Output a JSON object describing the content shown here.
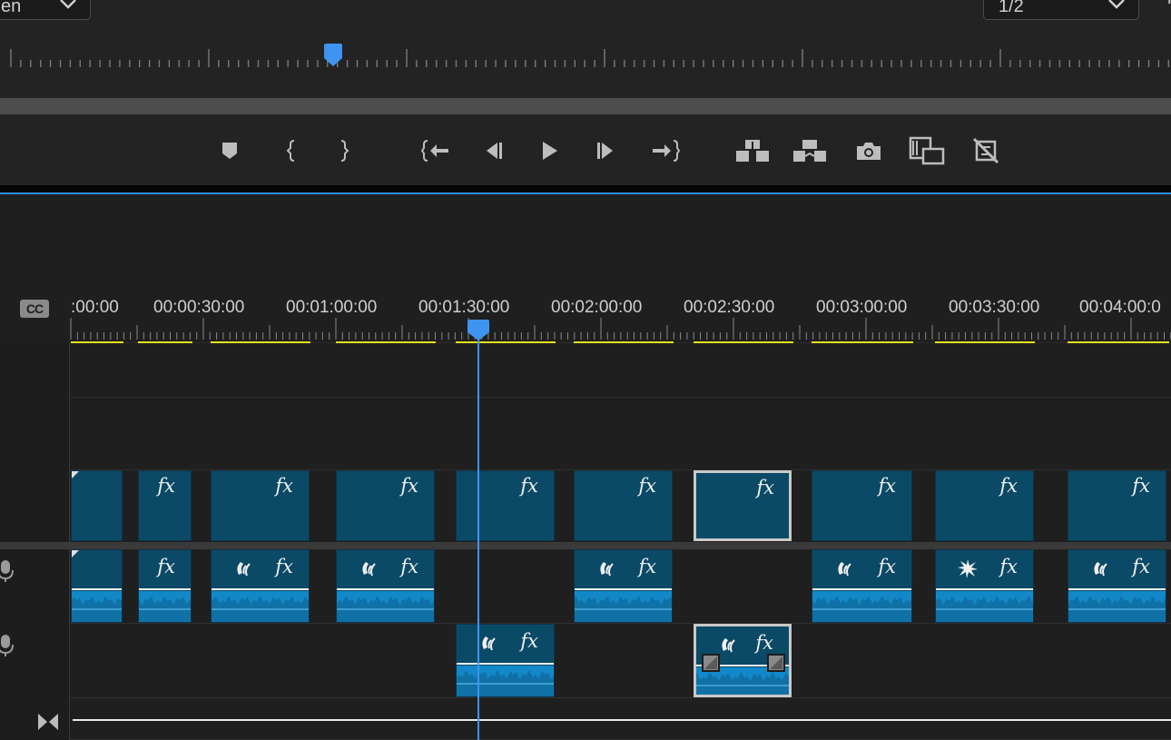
{
  "monitor": {
    "fit_value": "en",
    "resolution_value": "1/2"
  },
  "transport": {
    "buttons": [
      {
        "name": "add-marker-icon"
      },
      {
        "name": "mark-in-icon"
      },
      {
        "name": "mark-out-icon"
      },
      {
        "name": "go-to-in-icon"
      },
      {
        "name": "step-back-icon"
      },
      {
        "name": "play-icon"
      },
      {
        "name": "step-forward-icon"
      },
      {
        "name": "go-to-out-icon"
      },
      {
        "name": "lift-icon"
      },
      {
        "name": "extract-icon"
      },
      {
        "name": "export-frame-icon"
      },
      {
        "name": "comparison-view-icon"
      },
      {
        "name": "toggle-proxies-icon"
      }
    ]
  },
  "timeline": {
    "cc_label": "CC",
    "timecodes": [
      ":00:00",
      "00:00:30:00",
      "00:01:00:00",
      "00:01:30:00",
      "00:02:00:00",
      "00:02:30:00",
      "00:03:00:00",
      "00:03:30:00",
      "00:04:00:0"
    ],
    "fx_label": "fx",
    "playhead_timecode_index": 3,
    "colors": {
      "clip": "#0b4a66",
      "waveform": "#1388c8",
      "render_bar": "#e6e021",
      "playhead": "#3e94f0"
    }
  }
}
